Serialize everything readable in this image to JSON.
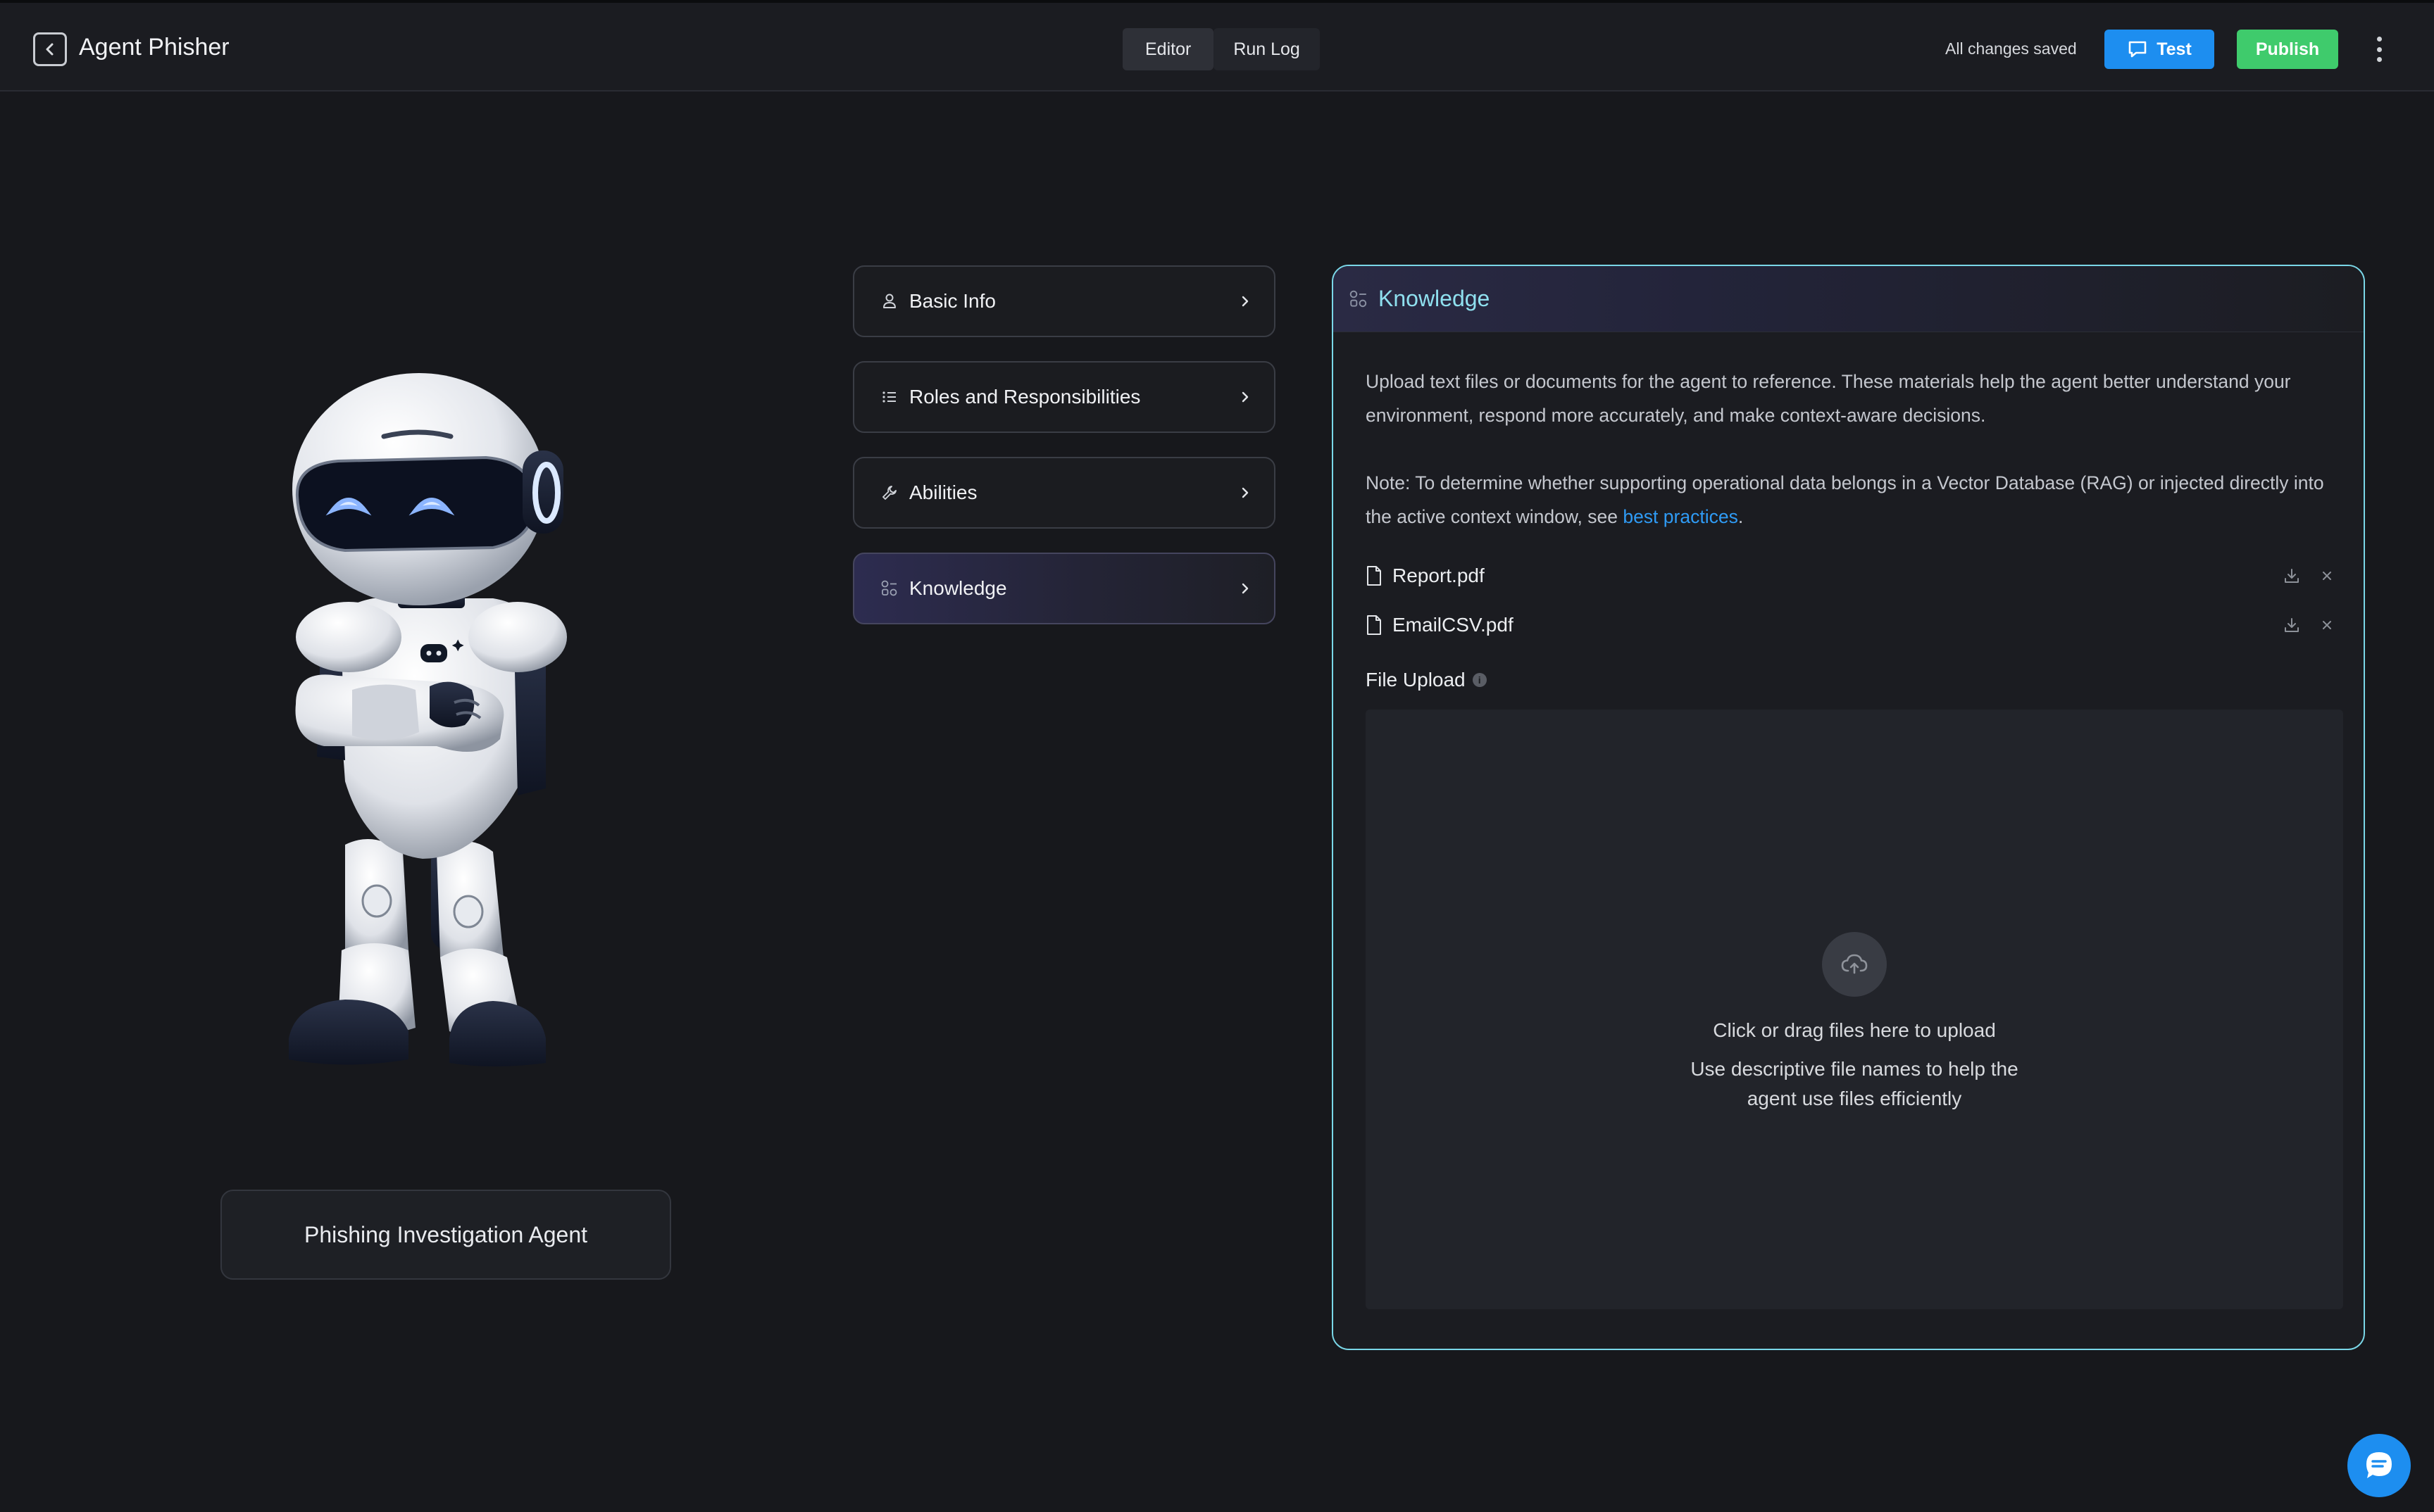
{
  "header": {
    "title": "Agent Phisher",
    "tabs": [
      {
        "label": "Editor",
        "active": true
      },
      {
        "label": "Run Log",
        "active": false
      }
    ],
    "save_status": "All changes saved",
    "test_label": "Test",
    "publish_label": "Publish"
  },
  "agent": {
    "name": "Phishing Investigation Agent",
    "avatar": "robot-illustration"
  },
  "sections": [
    {
      "label": "Basic Info",
      "icon": "person-icon",
      "active": false
    },
    {
      "label": "Roles and Responsibilities",
      "icon": "list-icon",
      "active": false
    },
    {
      "label": "Abilities",
      "icon": "wrench-icon",
      "active": false
    },
    {
      "label": "Knowledge",
      "icon": "knowledge-icon",
      "active": true
    }
  ],
  "knowledge": {
    "title": "Knowledge",
    "description": "Upload text files or documents for the agent to reference. These materials help the agent better understand your environment, respond more accurately, and make context-aware decisions.",
    "note_prefix": "Note: To determine whether supporting operational data belongs in a Vector Database (RAG) or injected directly into the active context window, see ",
    "note_link": "best practices",
    "note_suffix": ".",
    "files": [
      {
        "name": "Report.pdf"
      },
      {
        "name": "EmailCSV.pdf"
      }
    ],
    "upload_label": "File Upload",
    "info_glyph": "i",
    "dropzone_main": "Click or drag files here to upload",
    "dropzone_hint": "Use descriptive file names to help the agent use files efficiently"
  },
  "colors": {
    "accent_blue": "#1d8ef0",
    "publish_green": "#3fcb6c",
    "panel_border": "#7ad7e8",
    "link": "#2f9bf5"
  }
}
